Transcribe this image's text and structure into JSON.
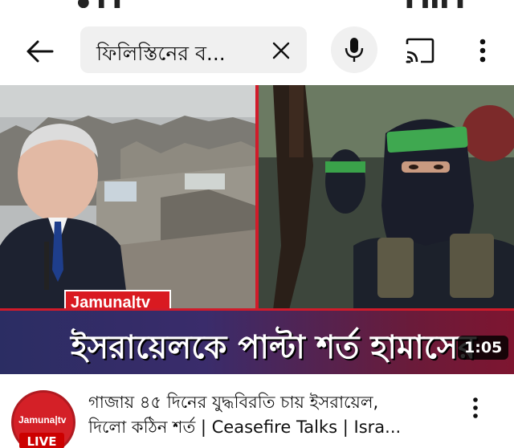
{
  "search": {
    "query": "ফিলিস্তিনের ব..."
  },
  "icons": {
    "back": "arrow-left-icon",
    "clear": "close-icon",
    "mic": "microphone-icon",
    "cast": "cast-icon",
    "more": "more-vert-icon"
  },
  "video": {
    "thumbnail_logo": "Jamuna|tv",
    "headline": "ইসরায়েলকে পাল্টা শর্ত হামাসের",
    "duration": "1:05",
    "channel_logo": "Jamuna|tv",
    "live_label": "LIVE",
    "title_line1": "গাজায় ৪৫ দিনের যুদ্ধবিরতি চায় ইসরায়েল,",
    "title_line2": "দিলো কঠিন শর্ত | Ceasefire Talks | Isra..."
  },
  "colors": {
    "brand_red": "#d91a21",
    "band_blue": "#2b2d63",
    "band_maroon": "#7e1530",
    "search_bg": "#f0f0f0"
  }
}
